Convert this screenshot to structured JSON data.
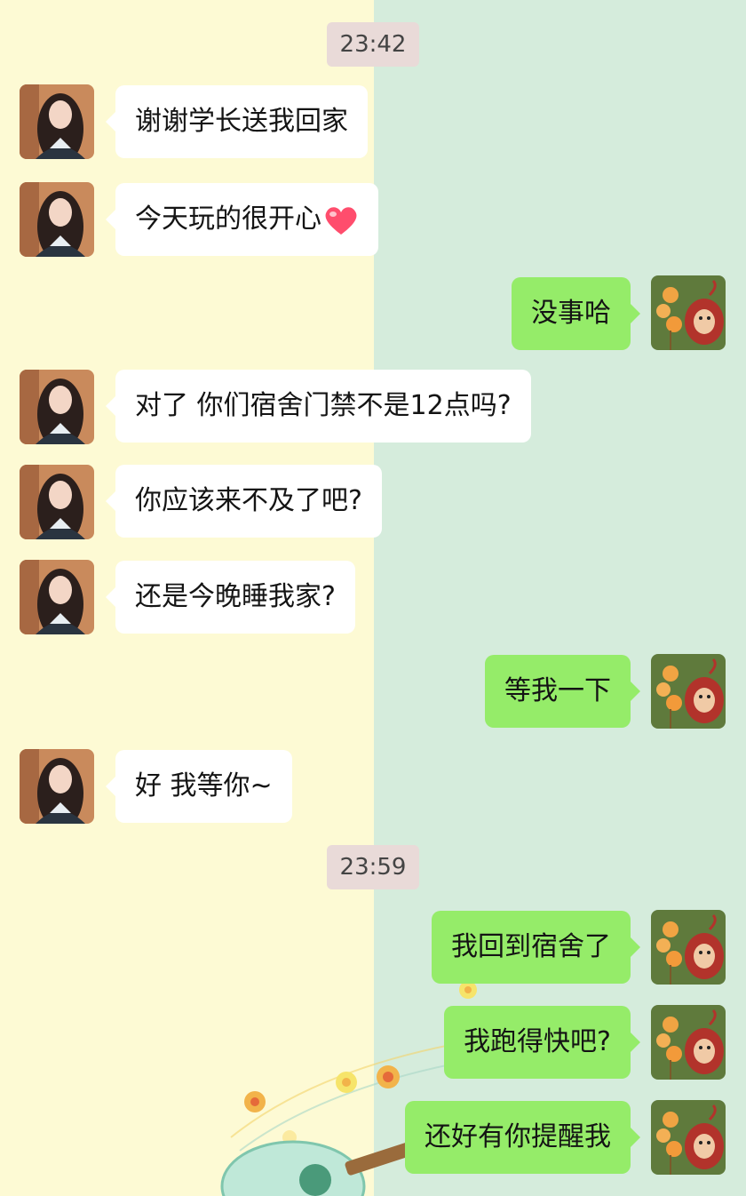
{
  "chat": {
    "timestamps": [
      "23:42",
      "23:59"
    ],
    "messages": [
      {
        "side": "in",
        "text": "谢谢学长送我回家"
      },
      {
        "side": "in",
        "text": "今天玩的很开心",
        "emoji": "heart-emoji"
      },
      {
        "side": "out",
        "text": "没事哈"
      },
      {
        "side": "in",
        "text": "对了 你们宿舍门禁不是12点吗?"
      },
      {
        "side": "in",
        "text": "你应该来不及了吧?"
      },
      {
        "side": "in",
        "text": "还是今晚睡我家?"
      },
      {
        "side": "out",
        "text": "等我一下"
      },
      {
        "side": "in",
        "text": "好 我等你~"
      },
      {
        "side": "out",
        "text": "我回到宿舍了"
      },
      {
        "side": "out",
        "text": "我跑得快吧?"
      },
      {
        "side": "out",
        "text": "还好有你提醒我"
      }
    ]
  },
  "colors": {
    "left_bg": "#fdfad4",
    "right_bg": "#d5ecdc",
    "incoming_bubble": "#ffffff",
    "outgoing_bubble": "#95ec69",
    "timestamp_bg": "#e9dad8"
  },
  "icons": {
    "contact_avatar": "girl-photo-avatar",
    "self_avatar": "teletubby-balloon-avatar",
    "background_decoration": "guitar-flowers-illustration"
  }
}
